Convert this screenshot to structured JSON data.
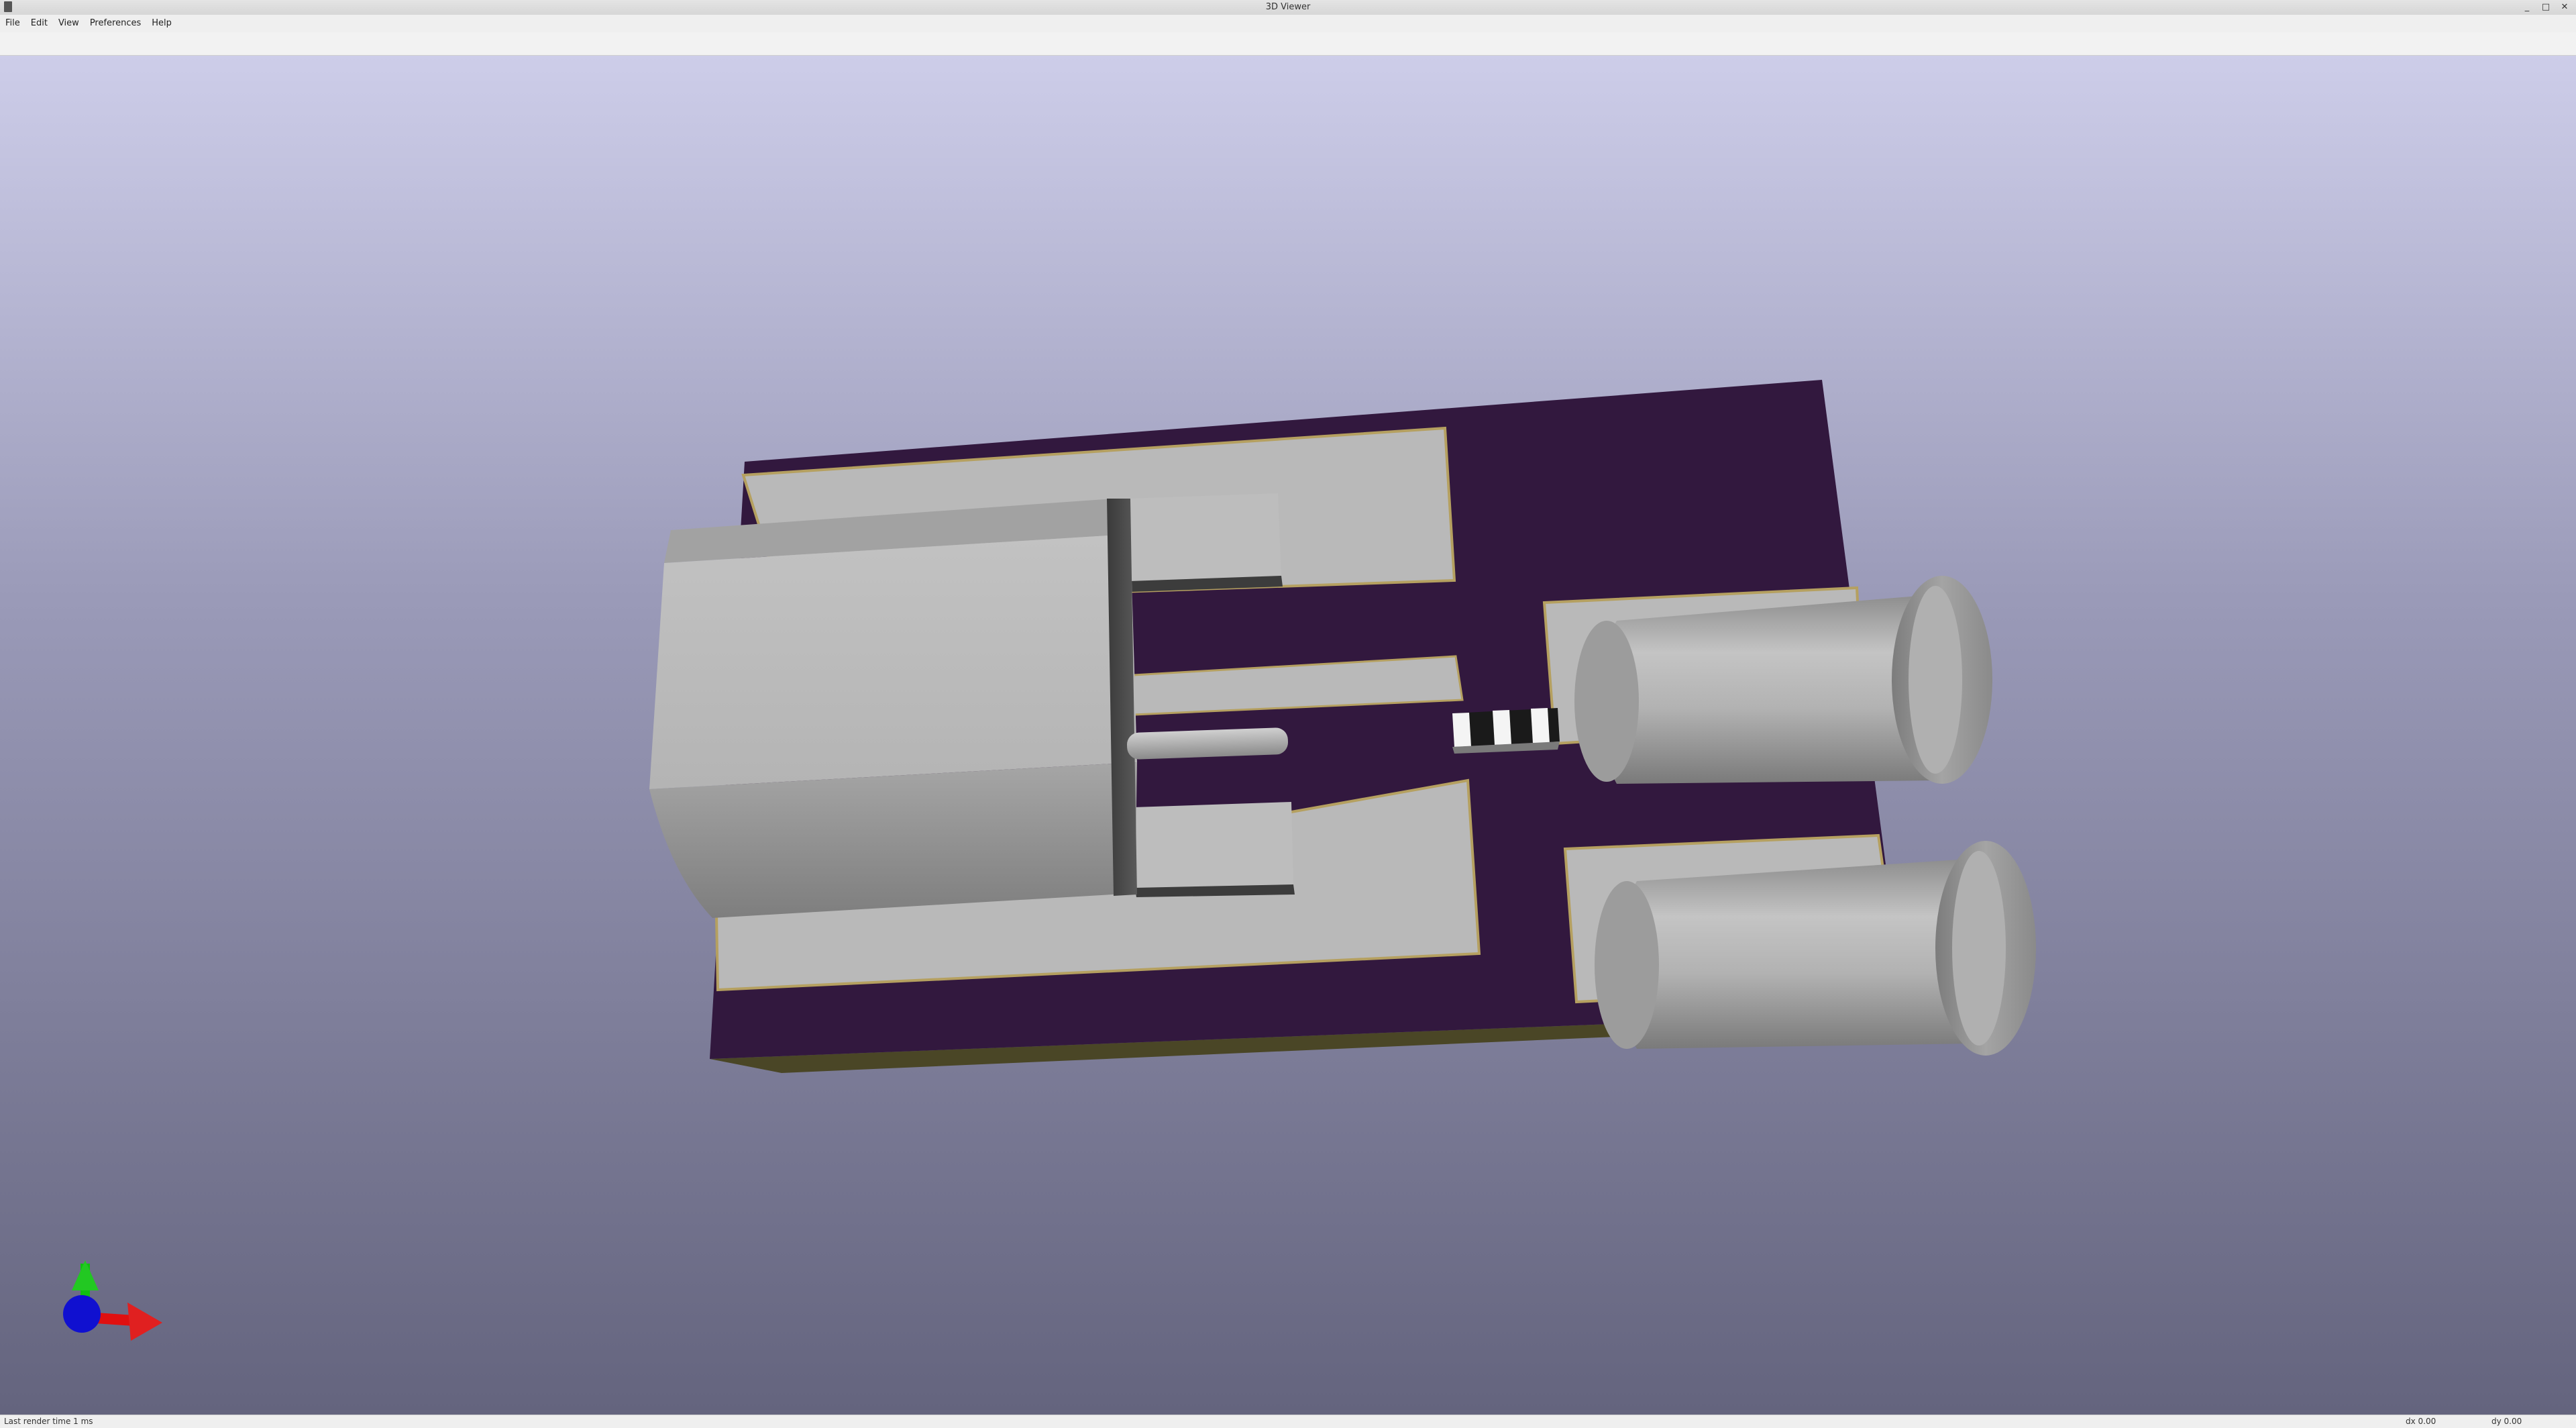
{
  "window": {
    "title": "3D Viewer"
  },
  "menu": {
    "file": "File",
    "edit": "Edit",
    "view": "View",
    "preferences": "Preferences",
    "help": "Help"
  },
  "status": {
    "render_time": "Last render time 1 ms",
    "dx": "dx 0.00",
    "dy": "dy 0.00"
  },
  "colors": {
    "board": "#32183e",
    "board_edge": "#4a4626",
    "copper_outline": "#b5a060",
    "component": "#b9b9b9",
    "viewport_top": "#cdcde9",
    "viewport_bottom": "#64647e",
    "axis_x": "#e01010",
    "axis_y": "#10c010",
    "axis_z": "#1010d0"
  },
  "icons": {
    "app": "app-icon",
    "minimize": "minimize-icon",
    "maximize": "maximize-icon",
    "close": "close-icon",
    "axis_gizmo": "axis-gizmo-icon"
  }
}
